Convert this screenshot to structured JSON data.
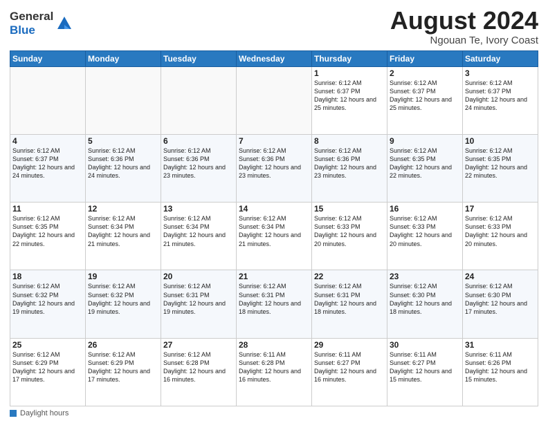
{
  "header": {
    "logo_general": "General",
    "logo_blue": "Blue",
    "month_year": "August 2024",
    "location": "Ngouan Te, Ivory Coast"
  },
  "days_of_week": [
    "Sunday",
    "Monday",
    "Tuesday",
    "Wednesday",
    "Thursday",
    "Friday",
    "Saturday"
  ],
  "weeks": [
    [
      {
        "day": "",
        "info": ""
      },
      {
        "day": "",
        "info": ""
      },
      {
        "day": "",
        "info": ""
      },
      {
        "day": "",
        "info": ""
      },
      {
        "day": "1",
        "info": "Sunrise: 6:12 AM\nSunset: 6:37 PM\nDaylight: 12 hours and 25 minutes."
      },
      {
        "day": "2",
        "info": "Sunrise: 6:12 AM\nSunset: 6:37 PM\nDaylight: 12 hours and 25 minutes."
      },
      {
        "day": "3",
        "info": "Sunrise: 6:12 AM\nSunset: 6:37 PM\nDaylight: 12 hours and 24 minutes."
      }
    ],
    [
      {
        "day": "4",
        "info": "Sunrise: 6:12 AM\nSunset: 6:37 PM\nDaylight: 12 hours and 24 minutes."
      },
      {
        "day": "5",
        "info": "Sunrise: 6:12 AM\nSunset: 6:36 PM\nDaylight: 12 hours and 24 minutes."
      },
      {
        "day": "6",
        "info": "Sunrise: 6:12 AM\nSunset: 6:36 PM\nDaylight: 12 hours and 23 minutes."
      },
      {
        "day": "7",
        "info": "Sunrise: 6:12 AM\nSunset: 6:36 PM\nDaylight: 12 hours and 23 minutes."
      },
      {
        "day": "8",
        "info": "Sunrise: 6:12 AM\nSunset: 6:36 PM\nDaylight: 12 hours and 23 minutes."
      },
      {
        "day": "9",
        "info": "Sunrise: 6:12 AM\nSunset: 6:35 PM\nDaylight: 12 hours and 22 minutes."
      },
      {
        "day": "10",
        "info": "Sunrise: 6:12 AM\nSunset: 6:35 PM\nDaylight: 12 hours and 22 minutes."
      }
    ],
    [
      {
        "day": "11",
        "info": "Sunrise: 6:12 AM\nSunset: 6:35 PM\nDaylight: 12 hours and 22 minutes."
      },
      {
        "day": "12",
        "info": "Sunrise: 6:12 AM\nSunset: 6:34 PM\nDaylight: 12 hours and 21 minutes."
      },
      {
        "day": "13",
        "info": "Sunrise: 6:12 AM\nSunset: 6:34 PM\nDaylight: 12 hours and 21 minutes."
      },
      {
        "day": "14",
        "info": "Sunrise: 6:12 AM\nSunset: 6:34 PM\nDaylight: 12 hours and 21 minutes."
      },
      {
        "day": "15",
        "info": "Sunrise: 6:12 AM\nSunset: 6:33 PM\nDaylight: 12 hours and 20 minutes."
      },
      {
        "day": "16",
        "info": "Sunrise: 6:12 AM\nSunset: 6:33 PM\nDaylight: 12 hours and 20 minutes."
      },
      {
        "day": "17",
        "info": "Sunrise: 6:12 AM\nSunset: 6:33 PM\nDaylight: 12 hours and 20 minutes."
      }
    ],
    [
      {
        "day": "18",
        "info": "Sunrise: 6:12 AM\nSunset: 6:32 PM\nDaylight: 12 hours and 19 minutes."
      },
      {
        "day": "19",
        "info": "Sunrise: 6:12 AM\nSunset: 6:32 PM\nDaylight: 12 hours and 19 minutes."
      },
      {
        "day": "20",
        "info": "Sunrise: 6:12 AM\nSunset: 6:31 PM\nDaylight: 12 hours and 19 minutes."
      },
      {
        "day": "21",
        "info": "Sunrise: 6:12 AM\nSunset: 6:31 PM\nDaylight: 12 hours and 18 minutes."
      },
      {
        "day": "22",
        "info": "Sunrise: 6:12 AM\nSunset: 6:31 PM\nDaylight: 12 hours and 18 minutes."
      },
      {
        "day": "23",
        "info": "Sunrise: 6:12 AM\nSunset: 6:30 PM\nDaylight: 12 hours and 18 minutes."
      },
      {
        "day": "24",
        "info": "Sunrise: 6:12 AM\nSunset: 6:30 PM\nDaylight: 12 hours and 17 minutes."
      }
    ],
    [
      {
        "day": "25",
        "info": "Sunrise: 6:12 AM\nSunset: 6:29 PM\nDaylight: 12 hours and 17 minutes."
      },
      {
        "day": "26",
        "info": "Sunrise: 6:12 AM\nSunset: 6:29 PM\nDaylight: 12 hours and 17 minutes."
      },
      {
        "day": "27",
        "info": "Sunrise: 6:12 AM\nSunset: 6:28 PM\nDaylight: 12 hours and 16 minutes."
      },
      {
        "day": "28",
        "info": "Sunrise: 6:11 AM\nSunset: 6:28 PM\nDaylight: 12 hours and 16 minutes."
      },
      {
        "day": "29",
        "info": "Sunrise: 6:11 AM\nSunset: 6:27 PM\nDaylight: 12 hours and 16 minutes."
      },
      {
        "day": "30",
        "info": "Sunrise: 6:11 AM\nSunset: 6:27 PM\nDaylight: 12 hours and 15 minutes."
      },
      {
        "day": "31",
        "info": "Sunrise: 6:11 AM\nSunset: 6:26 PM\nDaylight: 12 hours and 15 minutes."
      }
    ]
  ],
  "footer": {
    "label": "Daylight hours"
  }
}
